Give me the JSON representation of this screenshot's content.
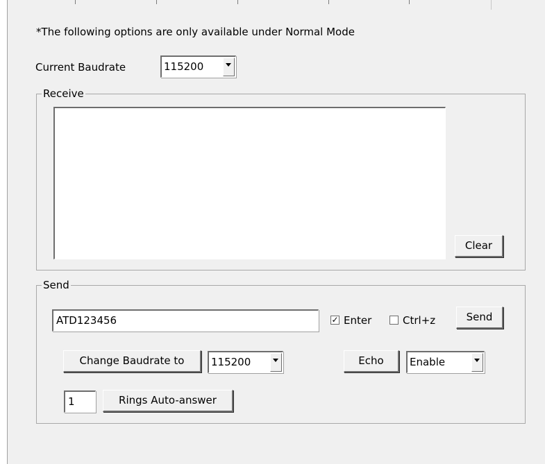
{
  "notice": "*The following options are only available under Normal Mode",
  "baudrate": {
    "label": "Current Baudrate",
    "value": "115200"
  },
  "receive": {
    "title": "Receive",
    "clear_label": "Clear"
  },
  "send": {
    "title": "Send",
    "input_value": "ATD123456",
    "enter_label": "Enter",
    "enter_checked": true,
    "ctrlz_label": "Ctrl+z",
    "ctrlz_checked": false,
    "send_label": "Send",
    "change_baud_label": "Change Baudrate to",
    "change_baud_value": "115200",
    "echo_label": "Echo",
    "echo_value": "Enable",
    "rings_value": "1",
    "rings_label": "Rings Auto-answer"
  },
  "icons": {
    "dropdown": "chevron-down-icon",
    "checkmark": "checkmark-icon"
  }
}
